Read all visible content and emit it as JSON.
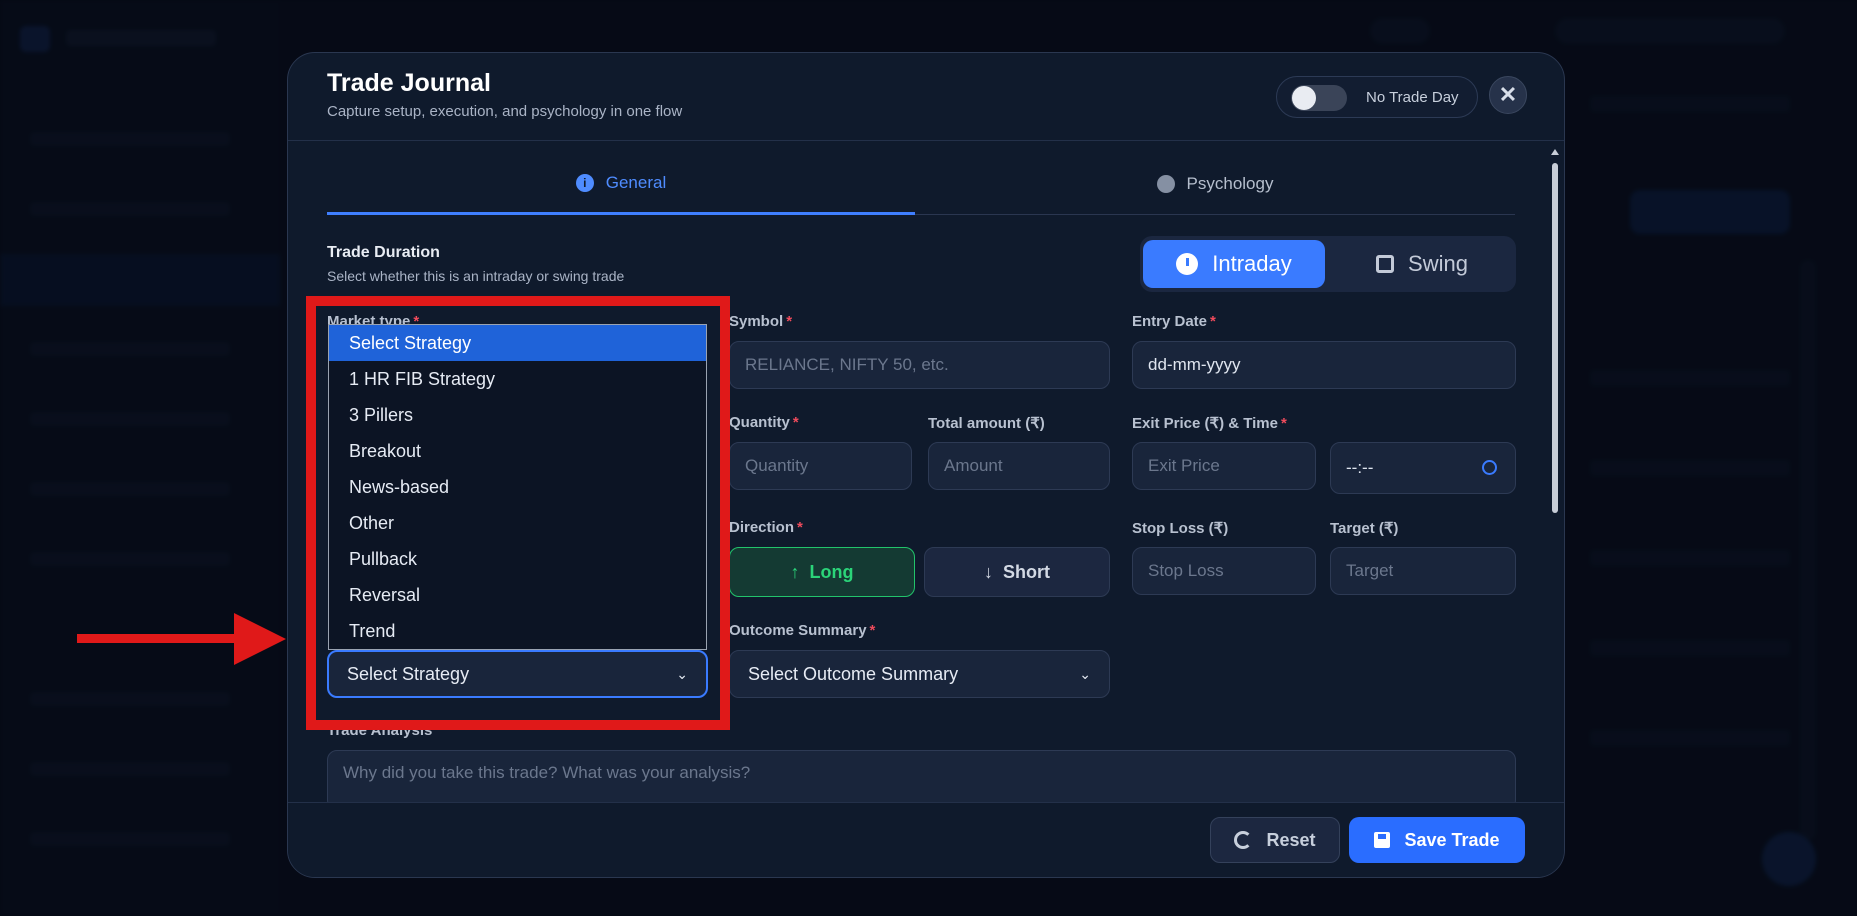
{
  "modal": {
    "title": "Trade Journal",
    "subtitle": "Capture setup, execution, and psychology in one flow",
    "no_trade_day_label": "No Trade Day",
    "close_symbol": "✕"
  },
  "tabs": [
    {
      "label": "General",
      "active": true
    },
    {
      "label": "Psychology",
      "active": false
    }
  ],
  "duration": {
    "title": "Trade Duration",
    "subtitle": "Select whether this is an intraday or swing trade",
    "options": [
      "Intraday",
      "Swing"
    ],
    "selected": "Intraday"
  },
  "fields": {
    "market_type_label": "Market type",
    "symbol_label": "Symbol",
    "symbol_placeholder": "RELIANCE, NIFTY 50, etc.",
    "entry_date_label": "Entry Date",
    "entry_date_value": "dd-mm-yyyy",
    "quantity_label": "Quantity",
    "quantity_placeholder": "Quantity",
    "total_amount_label": "Total amount (₹)",
    "total_amount_placeholder": "Amount",
    "exit_label": "Exit Price (₹) & Time",
    "exit_price_placeholder": "Exit Price",
    "exit_time_value": "--:--",
    "direction_label": "Direction",
    "long_label": "Long",
    "short_label": "Short",
    "stop_loss_label": "Stop Loss (₹)",
    "stop_loss_placeholder": "Stop Loss",
    "target_label": "Target (₹)",
    "target_placeholder": "Target",
    "strategy_value": "Select Strategy",
    "outcome_label": "Outcome Summary",
    "outcome_value": "Select Outcome Summary",
    "analysis_label": "Trade Analysis",
    "analysis_placeholder": "Why did you take this trade? What was your analysis?"
  },
  "strategy_options": [
    "Select Strategy",
    "1 HR FIB Strategy",
    "3 Pillers",
    "Breakout",
    "News-based",
    "Other",
    "Pullback",
    "Reversal",
    "Trend"
  ],
  "footer": {
    "reset_label": "Reset",
    "save_label": "Save Trade"
  },
  "colors": {
    "accent": "#3a7bff",
    "long_green": "#2bd479",
    "required_red": "#ef4b5c",
    "annotation_red": "#e01919"
  }
}
